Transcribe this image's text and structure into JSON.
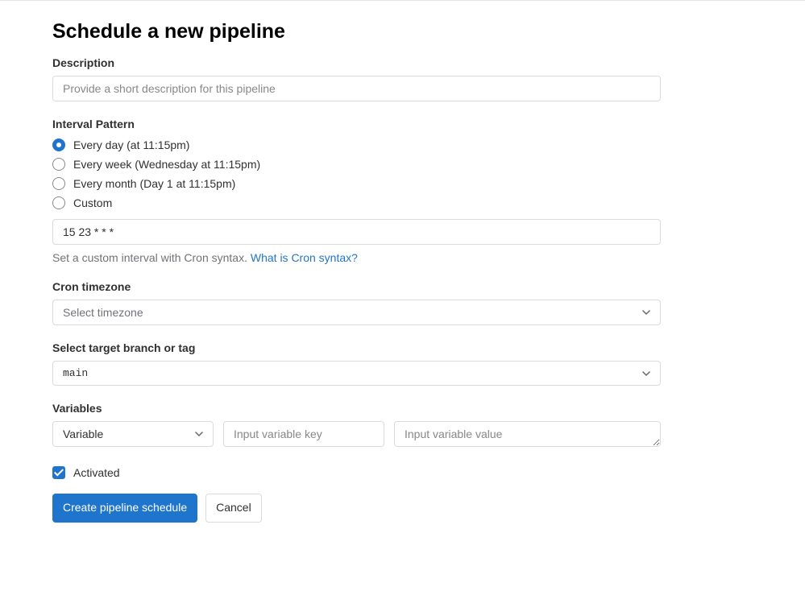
{
  "page": {
    "title": "Schedule a new pipeline"
  },
  "description": {
    "label": "Description",
    "placeholder": "Provide a short description for this pipeline",
    "value": ""
  },
  "interval": {
    "label": "Interval Pattern",
    "options": {
      "daily": "Every day (at 11:15pm)",
      "weekly": "Every week (Wednesday at 11:15pm)",
      "monthly": "Every month (Day 1 at 11:15pm)",
      "custom": "Custom"
    },
    "cron_value": "15 23 * * *",
    "help_text": "Set a custom interval with Cron syntax. ",
    "help_link": "What is Cron syntax?"
  },
  "timezone": {
    "label": "Cron timezone",
    "placeholder": "Select timezone"
  },
  "branch": {
    "label": "Select target branch or tag",
    "value": "main"
  },
  "variables": {
    "label": "Variables",
    "type_value": "Variable",
    "key_placeholder": "Input variable key",
    "value_placeholder": "Input variable value"
  },
  "activated": {
    "label": "Activated"
  },
  "buttons": {
    "submit": "Create pipeline schedule",
    "cancel": "Cancel"
  }
}
